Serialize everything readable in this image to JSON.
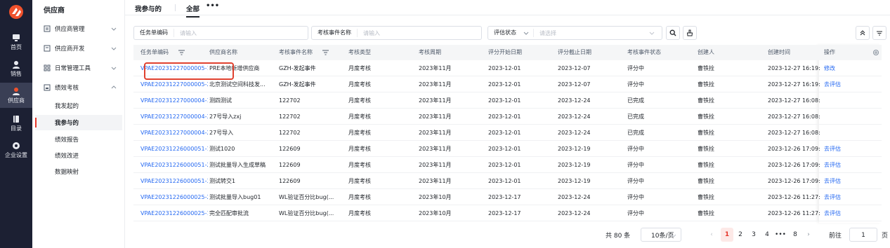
{
  "rail": {
    "items": [
      {
        "label": "首页",
        "icon": "monitor-icon"
      },
      {
        "label": "销售",
        "icon": "person-icon"
      },
      {
        "label": "供应商",
        "icon": "person-icon"
      },
      {
        "label": "目录",
        "icon": "book-icon"
      },
      {
        "label": "企业设置",
        "icon": "gear-icon"
      }
    ]
  },
  "sidebar": {
    "title": "供应商",
    "groups": [
      {
        "label": "供应商管理"
      },
      {
        "label": "供应商开发"
      },
      {
        "label": "日常管理工具"
      },
      {
        "label": "绩效考核"
      }
    ],
    "sub_items": [
      {
        "label": "我发起的"
      },
      {
        "label": "我参与的"
      },
      {
        "label": "绩效报告"
      },
      {
        "label": "绩效改进"
      },
      {
        "label": "数据映射"
      }
    ]
  },
  "tabs": {
    "participated": "我参与的",
    "all": "全部",
    "more": "•••"
  },
  "filters": {
    "task_code_label": "任务单编码",
    "task_code_placeholder": "请输入",
    "event_name_label": "考核事件名称",
    "event_name_placeholder": "请输入",
    "eval_status_label": "评估状态",
    "eval_status_placeholder": "请选择"
  },
  "table": {
    "headers": [
      "任务单编码",
      "供应商名称",
      "考核事件名称",
      "考核类型",
      "考核周期",
      "评分开始日期",
      "评分截止日期",
      "考核事件状态",
      "创建人",
      "创建时间",
      "操作"
    ],
    "rows": [
      [
        "VPAE20231227000005-1",
        "PRE本地新增供应商",
        "GZH-发起事件",
        "月度考核",
        "2023年11月",
        "2023-12-01",
        "2023-12-07",
        "评分中",
        "曹铁拴",
        "2023-12-27 16:19:",
        "修改"
      ],
      [
        "VPAE20231227000005-2",
        "北京测试空间科技发...",
        "GZH-发起事件",
        "月度考核",
        "2023年11月",
        "2023-12-01",
        "2023-12-07",
        "评分中",
        "曹铁拴",
        "2023-12-27 16:19:",
        "去评估"
      ],
      [
        "VPAE20231227000004-1",
        "测四测试",
        "122702",
        "月度考核",
        "2023年11月",
        "2023-12-01",
        "2023-12-24",
        "已完成",
        "曹铁拴",
        "2023-12-27 16:08:",
        ""
      ],
      [
        "VPAE20231227000004-3",
        "27号导入zxj",
        "122702",
        "月度考核",
        "2023年11月",
        "2023-12-01",
        "2023-12-24",
        "已完成",
        "曹铁拴",
        "2023-12-27 16:08:",
        ""
      ],
      [
        "VPAE20231227000004-2",
        "27号导入",
        "122702",
        "月度考核",
        "2023年11月",
        "2023-12-01",
        "2023-12-24",
        "已完成",
        "曹铁拴",
        "2023-12-27 16:08:",
        ""
      ],
      [
        "VPAE20231226000051-1",
        "测试1020",
        "122609",
        "月度考核",
        "2023年11月",
        "2023-12-01",
        "2023-12-19",
        "评分中",
        "曹铁拴",
        "2023-12-26 17:09:",
        "去评估"
      ],
      [
        "VPAE20231226000051-2",
        "测试批量导入生成草稿",
        "122609",
        "月度考核",
        "2023年11月",
        "2023-12-01",
        "2023-12-19",
        "评分中",
        "曹铁拴",
        "2023-12-26 17:09:",
        "去评估"
      ],
      [
        "VPAE20231226000051-3",
        "测试转交1",
        "122609",
        "月度考核",
        "2023年11月",
        "2023-12-01",
        "2023-12-19",
        "评分中",
        "曹铁拴",
        "2023-12-26 17:09:",
        "去评估"
      ],
      [
        "VPAE20231226000025-2",
        "测试批量导入bug01",
        "WL验证百分比bug(...",
        "月度考核",
        "2023年10月",
        "2023-12-17",
        "2023-12-24",
        "评分中",
        "曹铁拴",
        "2023-12-26 11:27:",
        "去评估"
      ],
      [
        "VPAE20231226000025-1",
        "完全匹配审批流",
        "WL验证百分比bug(...",
        "月度考核",
        "2023年10月",
        "2023-12-17",
        "2023-12-24",
        "评分中",
        "曹铁拴",
        "2023-12-26 11:27:",
        "去评估"
      ]
    ]
  },
  "pagination": {
    "total": "共 80 条",
    "page_size": "10条/页",
    "pages": [
      "1",
      "2",
      "3",
      "4",
      "•••",
      "8"
    ],
    "prev": "‹",
    "next": "›",
    "goto_label": "前往",
    "goto_value": "1",
    "page_unit": "页"
  },
  "colors": {
    "accent": "#e5362a",
    "link": "#2468f2",
    "rail_bg": "#1c2033"
  }
}
